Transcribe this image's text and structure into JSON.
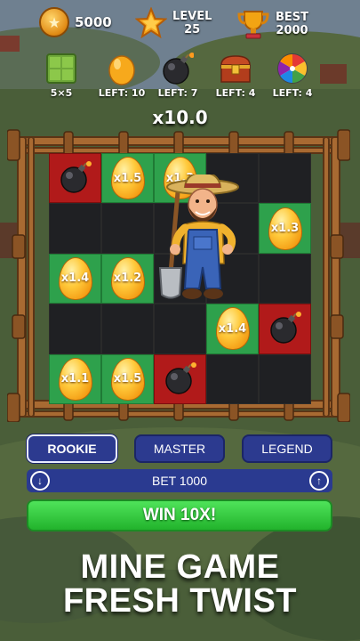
{
  "header": {
    "coins": "5000",
    "level_label": "LEVEL",
    "level_value": "25",
    "best_label": "BEST",
    "best_value": "2000"
  },
  "items": [
    {
      "icon": "grid-icon",
      "label": "5×5"
    },
    {
      "icon": "egg-icon",
      "label": "LEFT: 10"
    },
    {
      "icon": "bomb-icon",
      "label": "LEFT: 7"
    },
    {
      "icon": "treasure-chest-icon",
      "label": "LEFT: 4"
    },
    {
      "icon": "prize-wheel-icon",
      "label": "LEFT: 4"
    }
  ],
  "multiplier": "x10.0",
  "board": [
    [
      {
        "type": "bomb"
      },
      {
        "type": "egg",
        "value": "x1.5"
      },
      {
        "type": "egg",
        "value": "x1.3"
      },
      {
        "type": "empty"
      },
      {
        "type": "empty"
      }
    ],
    [
      {
        "type": "empty"
      },
      {
        "type": "empty"
      },
      {
        "type": "empty"
      },
      {
        "type": "empty"
      },
      {
        "type": "egg",
        "value": "x1.3"
      }
    ],
    [
      {
        "type": "egg",
        "value": "x1.4"
      },
      {
        "type": "egg",
        "value": "x1.2"
      },
      {
        "type": "empty"
      },
      {
        "type": "empty"
      },
      {
        "type": "empty"
      }
    ],
    [
      {
        "type": "empty"
      },
      {
        "type": "empty"
      },
      {
        "type": "empty"
      },
      {
        "type": "egg",
        "value": "x1.4"
      },
      {
        "type": "bomb"
      }
    ],
    [
      {
        "type": "egg",
        "value": "x1.1"
      },
      {
        "type": "egg",
        "value": "x1.5"
      },
      {
        "type": "bomb"
      },
      {
        "type": "empty"
      },
      {
        "type": "empty"
      }
    ]
  ],
  "difficulty": {
    "rookie": "ROOKIE",
    "master": "MASTER",
    "legend": "LEGEND",
    "selected": "ROOKIE"
  },
  "bet": {
    "label": "BET 1000",
    "decrease_icon": "arrow-down-icon",
    "increase_icon": "arrow-up-icon"
  },
  "win_button": "WIN 10X!",
  "promo": {
    "line1": "MINE GAME",
    "line2": "FRESH TWIST"
  },
  "colors": {
    "egg_cell": "#2ea14c",
    "bomb_cell": "#b11a1a",
    "empty_cell": "#1f2023",
    "button_blue": "#2c3a8f",
    "win_green": "#22b32c"
  }
}
